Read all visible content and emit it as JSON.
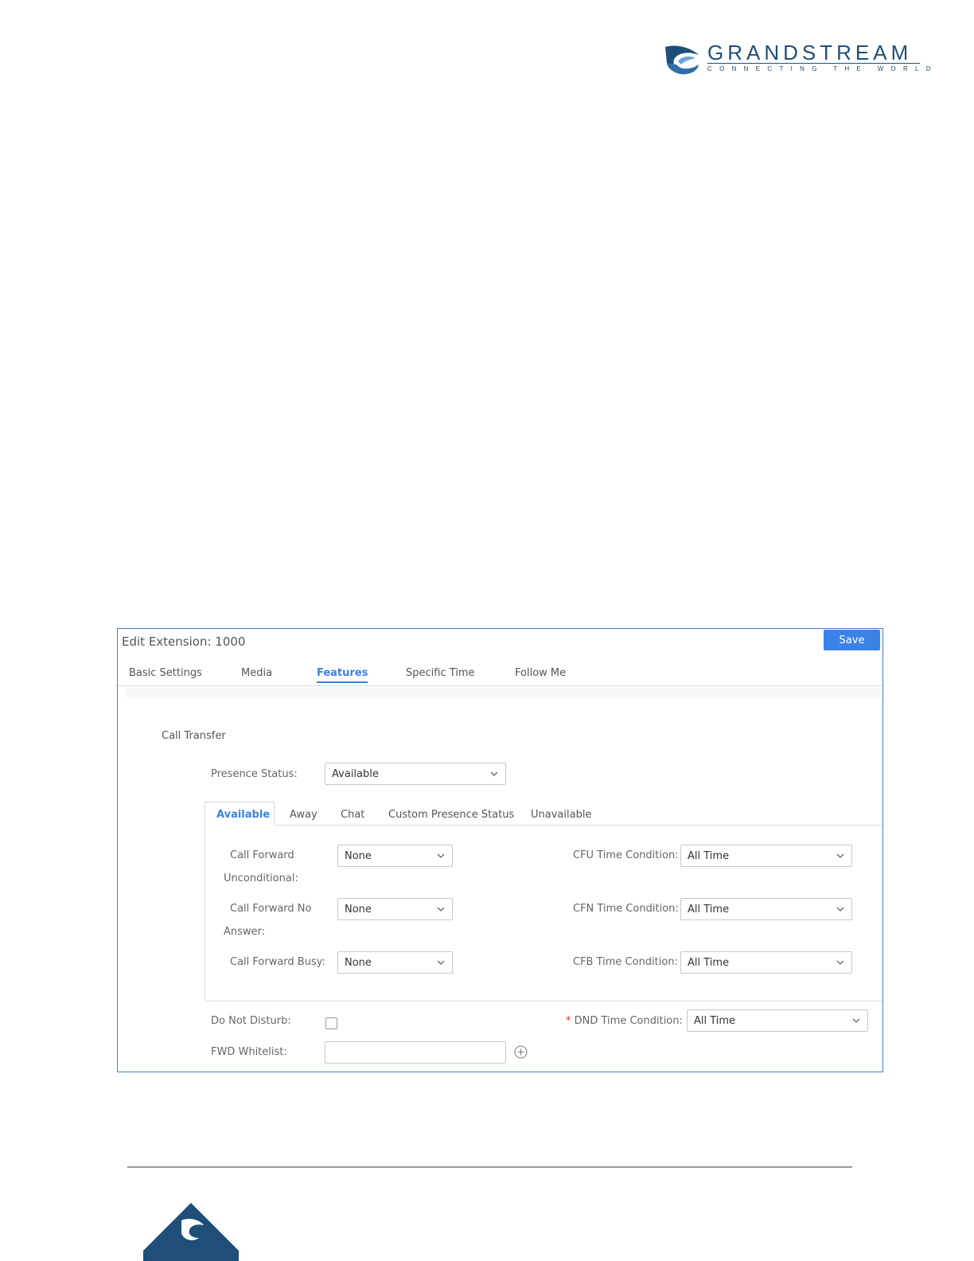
{
  "header": {
    "brand": "GRANDSTREAM",
    "tagline": "CONNECTING THE WORLD"
  },
  "dialog": {
    "title": "Edit Extension: 1000",
    "save_label": "Save",
    "tabs": [
      {
        "label": "Basic Settings",
        "active": false
      },
      {
        "label": "Media",
        "active": false
      },
      {
        "label": "Features",
        "active": true
      },
      {
        "label": "Specific Time",
        "active": false
      },
      {
        "label": "Follow Me",
        "active": false
      }
    ],
    "section_title": "Call Transfer",
    "presence_status": {
      "label": "Presence Status:",
      "value": "Available"
    },
    "presence_tabs": [
      {
        "label": "Available",
        "active": true
      },
      {
        "label": "Away",
        "active": false
      },
      {
        "label": "Chat",
        "active": false
      },
      {
        "label": "Custom Presence Status",
        "active": false
      },
      {
        "label": "Unavailable",
        "active": false
      }
    ],
    "forward": {
      "cfu": {
        "label_line1": "Call Forward",
        "label_line2": "Unconditional:",
        "value": "None",
        "time_label": "CFU Time Condition:",
        "time_value": "All Time"
      },
      "cfn": {
        "label_line1": "Call Forward No",
        "label_line2": "Answer:",
        "value": "None",
        "time_label": "CFN Time Condition:",
        "time_value": "All Time"
      },
      "cfb": {
        "label": "Call Forward Busy:",
        "value": "None",
        "time_label": "CFB Time Condition:",
        "time_value": "All Time"
      }
    },
    "dnd": {
      "label": "Do Not Disturb:",
      "checked": false,
      "required_mark": "*",
      "time_label": "DND Time Condition:",
      "time_value": "All Time"
    },
    "fwd_whitelist": {
      "label": "FWD Whitelist:",
      "value": ""
    }
  },
  "colors": {
    "accent": "#3b82e6",
    "brand": "#1f4e79",
    "border": "#3f83c9"
  },
  "icons": [
    "grandstream-logo",
    "chevron-down-icon",
    "add-circle-icon"
  ]
}
